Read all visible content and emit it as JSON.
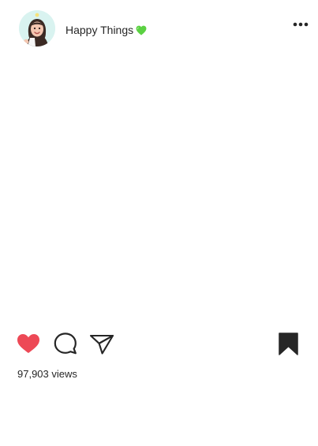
{
  "post": {
    "account_name": "Happy Things",
    "account_emoji": "green-heart-emoji",
    "views_count": "97,903",
    "views_suffix": "views",
    "liked": true,
    "saved": true
  },
  "icons": {
    "like": "heart-icon",
    "comment": "comment-icon",
    "share": "send-icon",
    "save": "bookmark-icon",
    "more": "more-options-icon"
  },
  "colors": {
    "like_active": "#ed4956",
    "text": "#262626",
    "avatar_background": "#d9f3f0",
    "emoji_green": "#5bd142"
  }
}
